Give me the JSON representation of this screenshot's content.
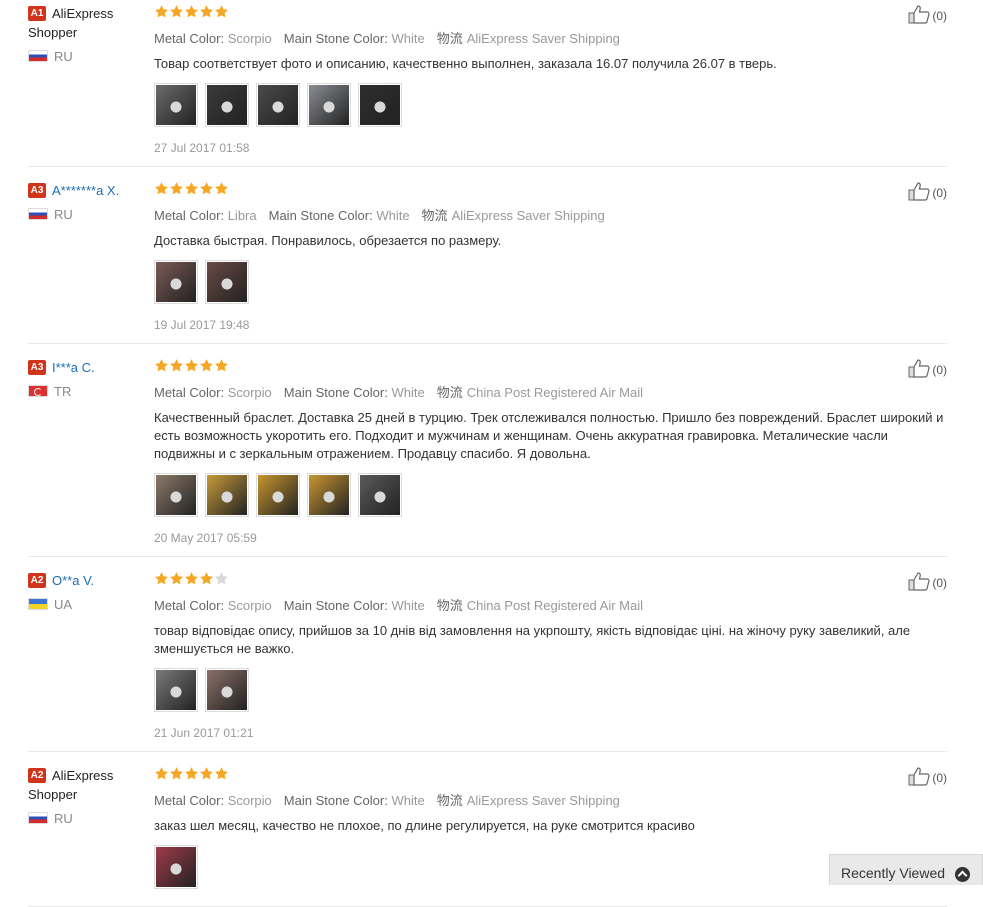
{
  "labels": {
    "metal_color": "Metal Color:",
    "main_stone_color": "Main Stone Color:",
    "shipping_cn": "物流"
  },
  "recently_viewed": "Recently Viewed",
  "colors": {
    "star": "#f5a623",
    "star_empty": "#d8d8d8",
    "badge": "#d0341b",
    "link": "#1c6db5"
  },
  "reviews": [
    {
      "level": "A1",
      "name": "AliExpress Shopper",
      "country": "RU",
      "flag": "ru",
      "rating": 5,
      "metal_color": "Scorpio",
      "stone_color": "White",
      "shipping": "AliExpress Saver Shipping",
      "text": "Товар соответствует фото и описанию, качественно выполнен, заказала 16.07 получила 26.07 в тверь.",
      "photo_count": 5,
      "photo_tones": [
        "#6b6b6b",
        "#3a3a3a",
        "#4a4a4a",
        "#8a8d92",
        "#2e2e2e"
      ],
      "date": "27 Jul 2017 01:58",
      "helpful": "(0)"
    },
    {
      "level": "A3",
      "name": "A*******a X.",
      "country": "RU",
      "flag": "ru",
      "rating": 5,
      "metal_color": "Libra",
      "stone_color": "White",
      "shipping": "AliExpress Saver Shipping",
      "text": "Доставка быстрая. Понравилось, обрезается по размеру.",
      "photo_count": 2,
      "photo_tones": [
        "#7a5a55",
        "#6a4a45"
      ],
      "date": "19 Jul 2017 19:48",
      "helpful": "(0)"
    },
    {
      "level": "A3",
      "name": "I***a C.",
      "country": "TR",
      "flag": "tr",
      "rating": 5,
      "metal_color": "Scorpio",
      "stone_color": "White",
      "shipping": "China Post Registered Air Mail",
      "text": "Качественный браслет. Доставка 25 дней в турцию. Трек отслеживался полностью. Пришло без повреждений. Браслет широкий и есть возможность укоротить его. Подходит и мужчинам и женщинам. Очень аккуратная гравировка. Металические часли подвижны и с зеркальным отражением. Продавцу спасибо. Я довольна.",
      "photo_count": 5,
      "photo_tones": [
        "#8c7a6a",
        "#c79a3a",
        "#c7952e",
        "#c99632",
        "#5a5a5a"
      ],
      "date": "20 May 2017 05:59",
      "helpful": "(0)"
    },
    {
      "level": "A2",
      "name": "O**a V.",
      "country": "UA",
      "flag": "ua",
      "rating": 4,
      "metal_color": "Scorpio",
      "stone_color": "White",
      "shipping": "China Post Registered Air Mail",
      "text": "товар відповідає опису, прийшов за 10 днів від замовлення на укрпошту, якість відповідає ціні. на жіночу руку завеликий, але зменшується не важко.",
      "photo_count": 2,
      "photo_tones": [
        "#7a7a7a",
        "#8a7068"
      ],
      "date": "21 Jun 2017 01:21",
      "helpful": "(0)"
    },
    {
      "level": "A2",
      "name": "AliExpress Shopper",
      "country": "RU",
      "flag": "ru",
      "rating": 5,
      "metal_color": "Scorpio",
      "stone_color": "White",
      "shipping": "AliExpress Saver Shipping",
      "text": "заказ шел месяц, качество не плохое, по длине регулируется, на руке смотрится красиво",
      "photo_count": 1,
      "photo_tones": [
        "#a03a4a"
      ],
      "date": "",
      "helpful": "(0)"
    }
  ]
}
